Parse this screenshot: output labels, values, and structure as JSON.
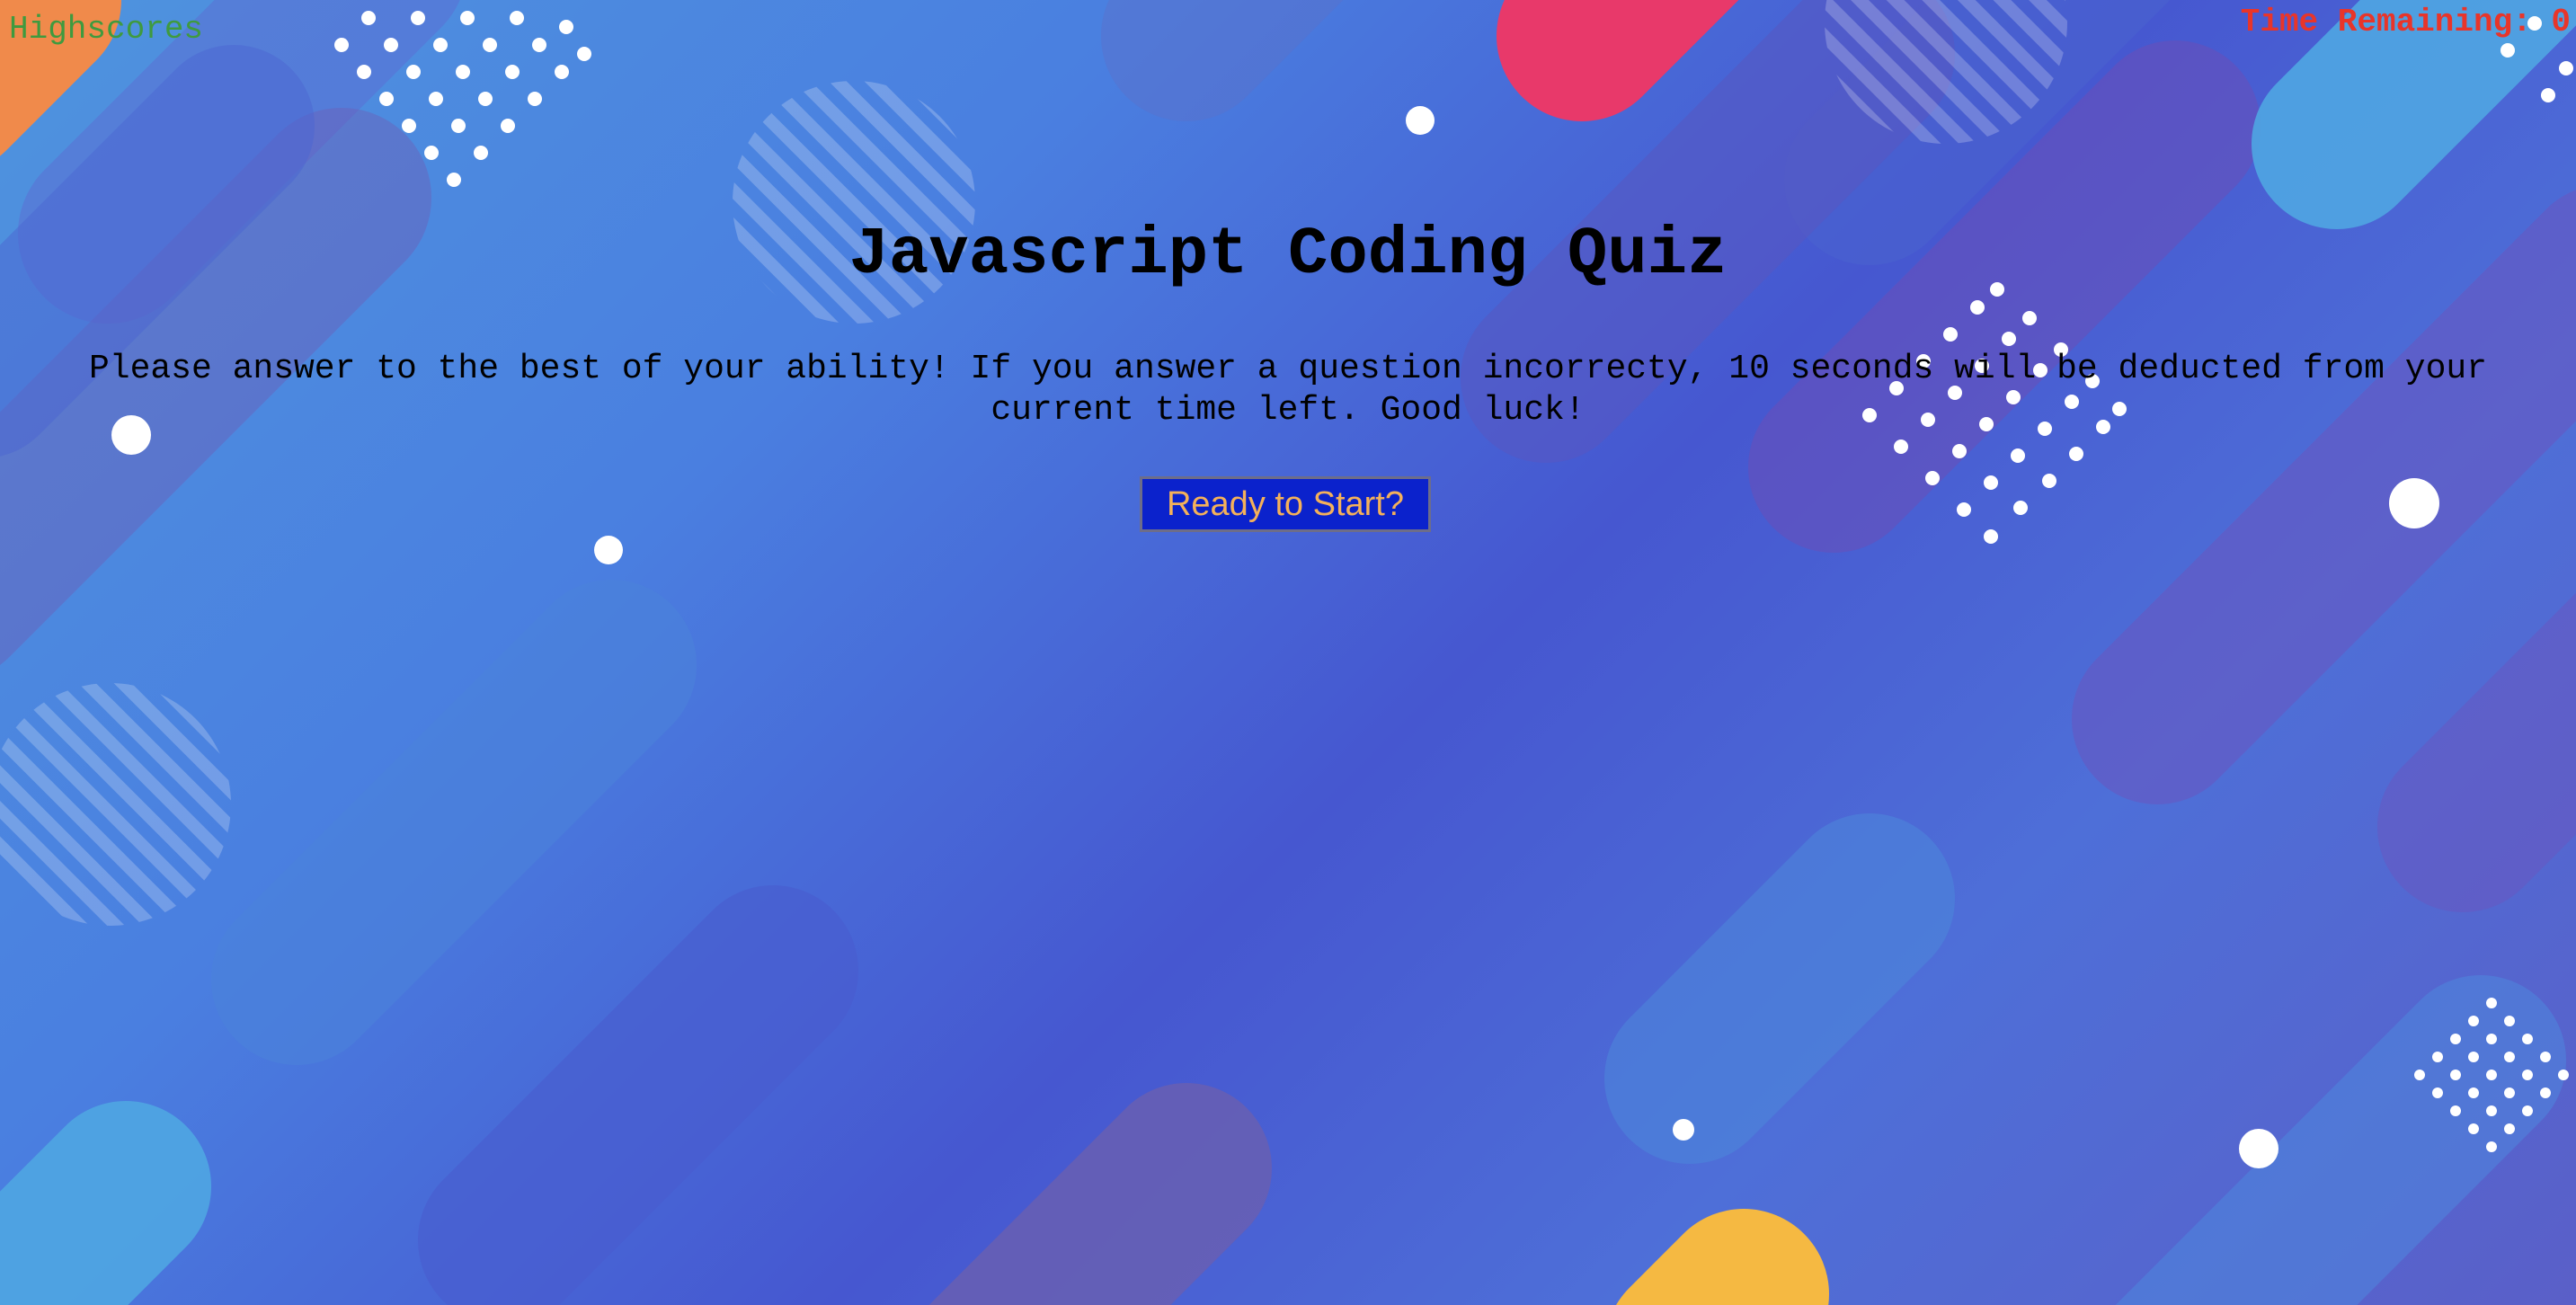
{
  "header": {
    "highscores_link": "Highscores",
    "timer_label": "Time Remaining: ",
    "timer_value": "0"
  },
  "main": {
    "title": "Javascript Coding Quiz",
    "description_line1": "Please answer to the best of your ability! If you answer a question incorrecty, 10 seconds will be deducted from your",
    "description_line2": "current time left. Good luck!",
    "start_button": "Ready to Start?"
  },
  "colors": {
    "highscores": "#3f9a3f",
    "timer": "#e8352a",
    "button_bg": "#0b22cc",
    "button_text": "#f4b15a",
    "background_blue": "#4a7fe0",
    "shape_orange": "#f08a4b",
    "shape_pink": "#e8396a",
    "shape_yellow": "#f5b942",
    "shape_purple": "#6a4fb8"
  }
}
